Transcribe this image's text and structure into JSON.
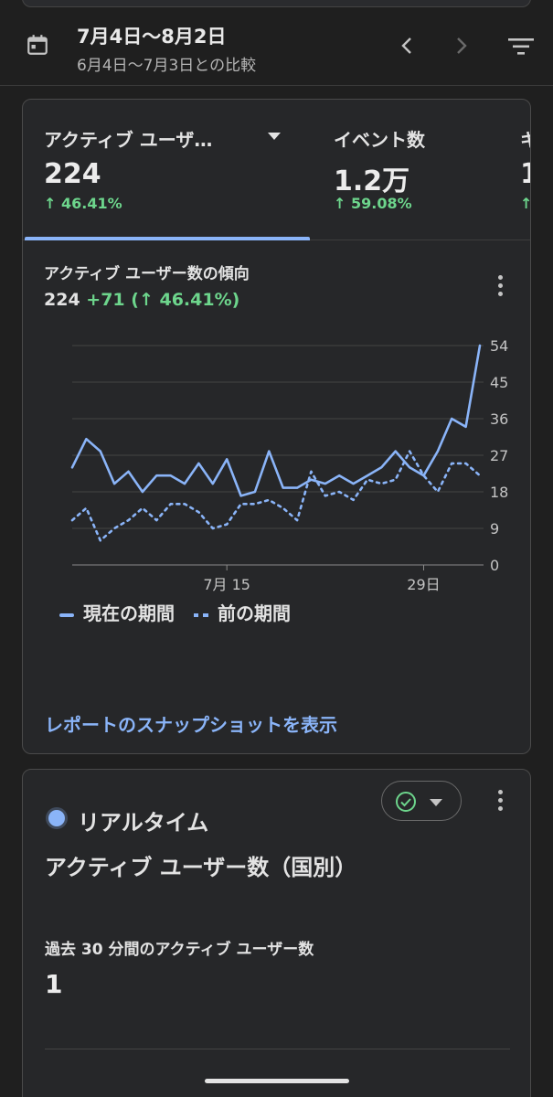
{
  "header": {
    "date_range": "7月4日〜8月2日",
    "compare_range": "6月4日〜7月3日との比較"
  },
  "metric_tabs": [
    {
      "label": "アクティブ ユーザ…",
      "value": "224",
      "delta": "↑ 46.41%",
      "selected": true
    },
    {
      "label": "イベント数",
      "value": "1.2万",
      "delta": "↑ 59.08%",
      "selected": false
    },
    {
      "label": "キ",
      "value": "1",
      "delta": "↑",
      "selected": false
    }
  ],
  "trend": {
    "title": "アクティブ ユーザー数の傾向",
    "total": "224",
    "change": "+71 (↑ 46.41%)",
    "report_link": "レポートのスナップショットを表示"
  },
  "chart_data": {
    "type": "line",
    "x": [
      "7月4日",
      "7月5日",
      "7月6日",
      "7月7日",
      "7月8日",
      "7月9日",
      "7月10日",
      "7月11日",
      "7月12日",
      "7月13日",
      "7月14日",
      "7月15日",
      "7月16日",
      "7月17日",
      "7月18日",
      "7月19日",
      "7月20日",
      "7月21日",
      "7月22日",
      "7月23日",
      "7月24日",
      "7月25日",
      "7月26日",
      "7月27日",
      "7月28日",
      "7月29日",
      "7月30日",
      "7月31日",
      "8月1日",
      "8月2日"
    ],
    "x_tick_labels": [
      "7月 15",
      "29日"
    ],
    "y_ticks": [
      0,
      9,
      18,
      27,
      36,
      45,
      54
    ],
    "ylim": [
      0,
      54
    ],
    "grid": true,
    "legend_position": "bottom-left",
    "series": [
      {
        "name": "現在の期間",
        "style": "solid",
        "color": "#8ab4f8",
        "values": [
          24,
          31,
          28,
          20,
          23,
          18,
          22,
          22,
          20,
          25,
          20,
          26,
          17,
          18,
          28,
          19,
          19,
          21,
          20,
          22,
          20,
          22,
          24,
          28,
          24,
          22,
          28,
          36,
          34,
          54
        ]
      },
      {
        "name": "前の期間",
        "style": "dotted",
        "color": "#8ab4f8",
        "values": [
          11,
          14,
          6,
          9,
          11,
          14,
          11,
          15,
          15,
          13,
          9,
          10,
          15,
          15,
          16,
          14,
          11,
          23,
          17,
          18,
          16,
          21,
          20,
          21,
          28,
          22,
          18,
          25,
          25,
          22
        ]
      }
    ]
  },
  "realtime": {
    "label": "リアルタイム",
    "title": "アクティブ ユーザー数（国別）",
    "subtitle": "過去 30 分間のアクティブ ユーザー数",
    "value": "1"
  },
  "icons": {
    "calendar": "calendar-icon",
    "prev": "chevron-left-icon",
    "next": "chevron-right-icon",
    "filter": "filter-icon",
    "more": "more-vert-icon",
    "status": "check-circle-icon"
  },
  "colors": {
    "accent": "#8ab4f8",
    "positive": "#6dd58c",
    "background": "#1f1f1f",
    "card": "#262729"
  }
}
